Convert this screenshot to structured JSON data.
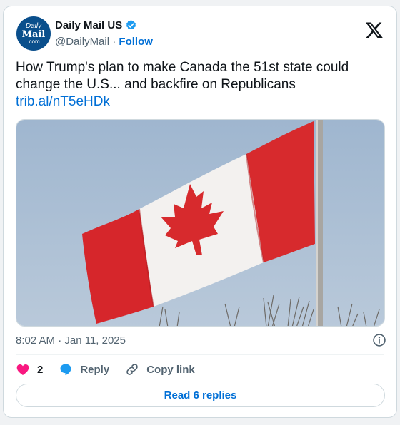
{
  "account": {
    "avatar_line1": "Daily",
    "avatar_line2": "Mail",
    "avatar_line3": ".com",
    "name": "Daily Mail US",
    "handle": "@DailyMail",
    "separator": " · ",
    "follow_label": "Follow"
  },
  "tweet": {
    "text": "How Trump's plan to make Canada the 51st state could change the U.S... and backfire on Republicans",
    "link": "trib.al/nT5eHDk",
    "timestamp": "8:02 AM · Jan 11, 2025"
  },
  "actions": {
    "like_count": "2",
    "reply_label": "Reply",
    "copy_link_label": "Copy link"
  },
  "footer": {
    "read_replies_label": "Read 6 replies"
  },
  "colors": {
    "link": "#006fd6",
    "like": "#f91880",
    "verified": "#1d9bf0",
    "avatar_bg": "#0a4f8c"
  }
}
